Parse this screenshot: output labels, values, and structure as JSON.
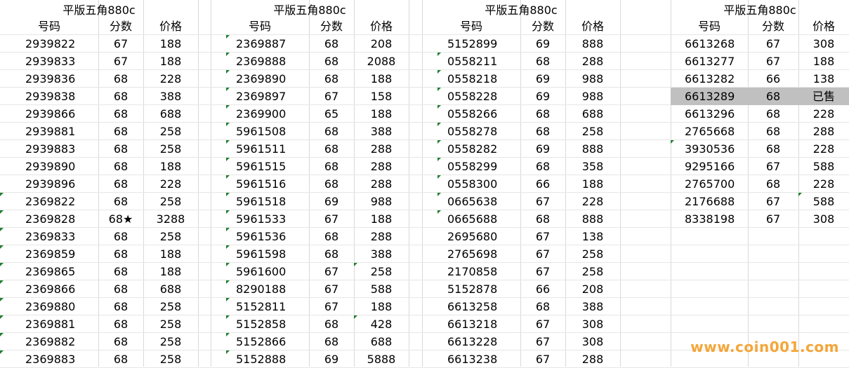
{
  "columns_header": {
    "num": "号码",
    "score": "分数",
    "price": "价格"
  },
  "blocks": [
    {
      "title": "平版五角880c",
      "rows": [
        {
          "n": "2939822",
          "s": "67",
          "p": "188"
        },
        {
          "n": "2939833",
          "s": "67",
          "p": "188"
        },
        {
          "n": "2939836",
          "s": "68",
          "p": "228"
        },
        {
          "n": "2939838",
          "s": "68",
          "p": "388"
        },
        {
          "n": "2939866",
          "s": "68",
          "p": "688"
        },
        {
          "n": "2939881",
          "s": "68",
          "p": "258"
        },
        {
          "n": "2939883",
          "s": "68",
          "p": "258"
        },
        {
          "n": "2939890",
          "s": "68",
          "p": "188"
        },
        {
          "n": "2939896",
          "s": "68",
          "p": "228"
        },
        {
          "n": "2369822",
          "s": "68",
          "p": "258"
        },
        {
          "n": "2369828",
          "s": "68★",
          "p": "3288"
        },
        {
          "n": "2369833",
          "s": "68",
          "p": "258"
        },
        {
          "n": "2369859",
          "s": "68",
          "p": "188"
        },
        {
          "n": "2369865",
          "s": "68",
          "p": "188"
        },
        {
          "n": "2369866",
          "s": "68",
          "p": "688"
        },
        {
          "n": "2369880",
          "s": "68",
          "p": "258"
        },
        {
          "n": "2369881",
          "s": "68",
          "p": "258"
        },
        {
          "n": "2369882",
          "s": "68",
          "p": "258"
        },
        {
          "n": "2369883",
          "s": "68",
          "p": "258"
        }
      ]
    },
    {
      "title": "平版五角880c",
      "rows": [
        {
          "n": "2369887",
          "s": "68",
          "p": "208"
        },
        {
          "n": "2369888",
          "s": "68",
          "p": "2088"
        },
        {
          "n": "2369890",
          "s": "68",
          "p": "188"
        },
        {
          "n": "2369897",
          "s": "67",
          "p": "158"
        },
        {
          "n": "2369900",
          "s": "65",
          "p": "188"
        },
        {
          "n": "5961508",
          "s": "68",
          "p": "388"
        },
        {
          "n": "5961511",
          "s": "68",
          "p": "288"
        },
        {
          "n": "5961515",
          "s": "68",
          "p": "288"
        },
        {
          "n": "5961516",
          "s": "68",
          "p": "288"
        },
        {
          "n": "5961518",
          "s": "69",
          "p": "988"
        },
        {
          "n": "5961533",
          "s": "67",
          "p": "188"
        },
        {
          "n": "5961536",
          "s": "68",
          "p": "288"
        },
        {
          "n": "5961598",
          "s": "68",
          "p": "388"
        },
        {
          "n": "5961600",
          "s": "67",
          "p": "258"
        },
        {
          "n": "8290188",
          "s": "67",
          "p": "588"
        },
        {
          "n": "5152811",
          "s": "67",
          "p": "188"
        },
        {
          "n": "5152858",
          "s": "68",
          "p": "428"
        },
        {
          "n": "5152866",
          "s": "68",
          "p": "688"
        },
        {
          "n": "5152888",
          "s": "69",
          "p": "5888"
        }
      ]
    },
    {
      "title": "平版五角880c",
      "rows": [
        {
          "n": "5152899",
          "s": "69",
          "p": "888"
        },
        {
          "n": "0558211",
          "s": "68",
          "p": "288"
        },
        {
          "n": "0558218",
          "s": "69",
          "p": "988"
        },
        {
          "n": "0558228",
          "s": "69",
          "p": "988"
        },
        {
          "n": "0558266",
          "s": "68",
          "p": "688"
        },
        {
          "n": "0558278",
          "s": "68",
          "p": "258"
        },
        {
          "n": "0558282",
          "s": "69",
          "p": "888"
        },
        {
          "n": "0558299",
          "s": "68",
          "p": "358"
        },
        {
          "n": "0558300",
          "s": "66",
          "p": "188"
        },
        {
          "n": "0665638",
          "s": "67",
          "p": "228"
        },
        {
          "n": "0665688",
          "s": "68",
          "p": "888"
        },
        {
          "n": "2695680",
          "s": "67",
          "p": "138"
        },
        {
          "n": "2765698",
          "s": "67",
          "p": "258"
        },
        {
          "n": "2170858",
          "s": "67",
          "p": "258"
        },
        {
          "n": "5152878",
          "s": "66",
          "p": "208"
        },
        {
          "n": "6613258",
          "s": "68",
          "p": "388"
        },
        {
          "n": "6613218",
          "s": "67",
          "p": "308"
        },
        {
          "n": "6613228",
          "s": "67",
          "p": "308"
        },
        {
          "n": "6613238",
          "s": "67",
          "p": "288"
        }
      ]
    },
    {
      "title": "平版五角880c",
      "rows": [
        {
          "n": "6613268",
          "s": "67",
          "p": "308"
        },
        {
          "n": "6613277",
          "s": "67",
          "p": "188"
        },
        {
          "n": "6613282",
          "s": "66",
          "p": "138"
        },
        {
          "n": "6613289",
          "s": "68",
          "p": "已售"
        },
        {
          "n": "6613296",
          "s": "68",
          "p": "228"
        },
        {
          "n": "2765668",
          "s": "68",
          "p": "288"
        },
        {
          "n": "3930536",
          "s": "68",
          "p": "228"
        },
        {
          "n": "9295166",
          "s": "67",
          "p": "588"
        },
        {
          "n": "2765700",
          "s": "68",
          "p": "228"
        },
        {
          "n": "2176688",
          "s": "67",
          "p": "588"
        },
        {
          "n": "8338198",
          "s": "67",
          "p": "308"
        }
      ]
    }
  ],
  "watermark": "www.coin001.com",
  "colors": {
    "sold_highlight": "#c0c0c0",
    "comment_marker": "#1e7f2e",
    "watermark": "#f4a63a"
  }
}
